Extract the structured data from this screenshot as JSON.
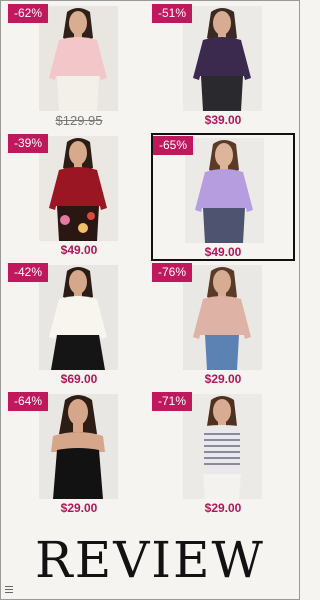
{
  "colors": {
    "badge": "#c0185c",
    "price": "#b01657",
    "background": "#f6f4f1"
  },
  "products": [
    {
      "discount": "-62%",
      "price": "$129.95",
      "strikethrough": true,
      "top_color": "#f3c7c9",
      "bottom_color": "#f3f0ea",
      "skin": "#d9ad91",
      "hair": "#2f2119",
      "bg": "#e9e6e1"
    },
    {
      "discount": "-51%",
      "price": "$39.00",
      "strikethrough": false,
      "top_color": "#3b2a4e",
      "bottom_color": "#2a2a2e",
      "skin": "#d8ac92",
      "hair": "#3a2a20",
      "bg": "#eceae7"
    },
    {
      "discount": "-39%",
      "price": "$49.00",
      "strikethrough": false,
      "top_color": "#9b1623",
      "bottom_color": "#2a1612",
      "skin": "#d8aa8c",
      "hair": "#2c1d15",
      "bg": "#ebe8e4"
    },
    {
      "discount": "-65%",
      "price": "$49.00",
      "strikethrough": false,
      "top_color": "#b59de0",
      "bottom_color": "#4e5470",
      "skin": "#ddb59b",
      "hair": "#5a3b27",
      "bg": "#eceae7"
    },
    {
      "discount": "-42%",
      "price": "$69.00",
      "strikethrough": false,
      "top_color": "#f8f5ef",
      "bottom_color": "#151515",
      "skin": "#d6a88b",
      "hair": "#2b1d16",
      "bg": "#e8e6e2"
    },
    {
      "discount": "-76%",
      "price": "$29.00",
      "strikethrough": false,
      "top_color": "#dfb2a6",
      "bottom_color": "#5c82b3",
      "skin": "#d8ac92",
      "hair": "#5a3b27",
      "bg": "#eae8e4"
    },
    {
      "discount": "-64%",
      "price": "$29.00",
      "strikethrough": false,
      "top_color": "#121212",
      "bottom_color": "#121212",
      "skin": "#d6a68b",
      "hair": "#2c1d15",
      "bg": "#e9e7e3"
    },
    {
      "discount": "-71%",
      "price": "$29.00",
      "strikethrough": false,
      "top_color": "#e9e8ea",
      "bottom_color": "#f3f2ef",
      "skin": "#d8ac92",
      "hair": "#4e321f",
      "bg": "#eceae7"
    }
  ],
  "review": {
    "title": "REVIEW"
  },
  "menu": {
    "icon": "menu-icon"
  }
}
